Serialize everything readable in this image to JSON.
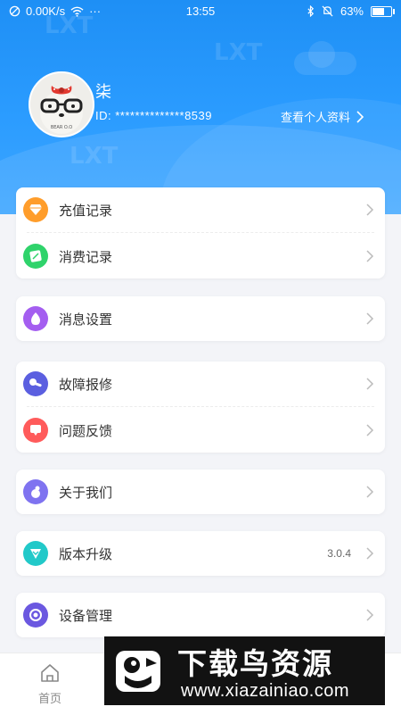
{
  "status_bar": {
    "network_speed": "0.00K/s",
    "more": "···",
    "time": "13:55",
    "battery": "63%"
  },
  "profile": {
    "nickname": "柒",
    "id_label": "ID:",
    "id_value": "**************8539",
    "view_profile": "查看个人资料",
    "avatar_icon": "bear-glasses-avatar"
  },
  "watermarks": [
    "LXT",
    "LXT",
    "LXT"
  ],
  "menu": {
    "card1": [
      {
        "label": "充值记录",
        "icon": "diamond-icon",
        "color": "#ff9d2b"
      },
      {
        "label": "消费记录",
        "icon": "ticket-icon",
        "color": "#2fd36b"
      }
    ],
    "card2": [
      {
        "label": "消息设置",
        "icon": "message-icon",
        "color": "#a45ef0"
      }
    ],
    "card3": [
      {
        "label": "故障报修",
        "icon": "wrench-icon",
        "color": "#5b5fe0"
      },
      {
        "label": "问题反馈",
        "icon": "feedback-icon",
        "color": "#ff5b5b"
      }
    ],
    "card4": [
      {
        "label": "关于我们",
        "icon": "info-icon",
        "color": "#7f73f0"
      }
    ],
    "card5": [
      {
        "label": "版本升级",
        "icon": "upgrade-icon",
        "color": "#22c9c9",
        "value": "3.0.4"
      }
    ],
    "card6": [
      {
        "label": "设备管理",
        "icon": "device-icon",
        "color": "#6b58e0"
      }
    ]
  },
  "tabbar": {
    "home": "首页"
  },
  "overlay": {
    "title": "下载鸟资源",
    "url": "www.xiazainiao.com"
  }
}
